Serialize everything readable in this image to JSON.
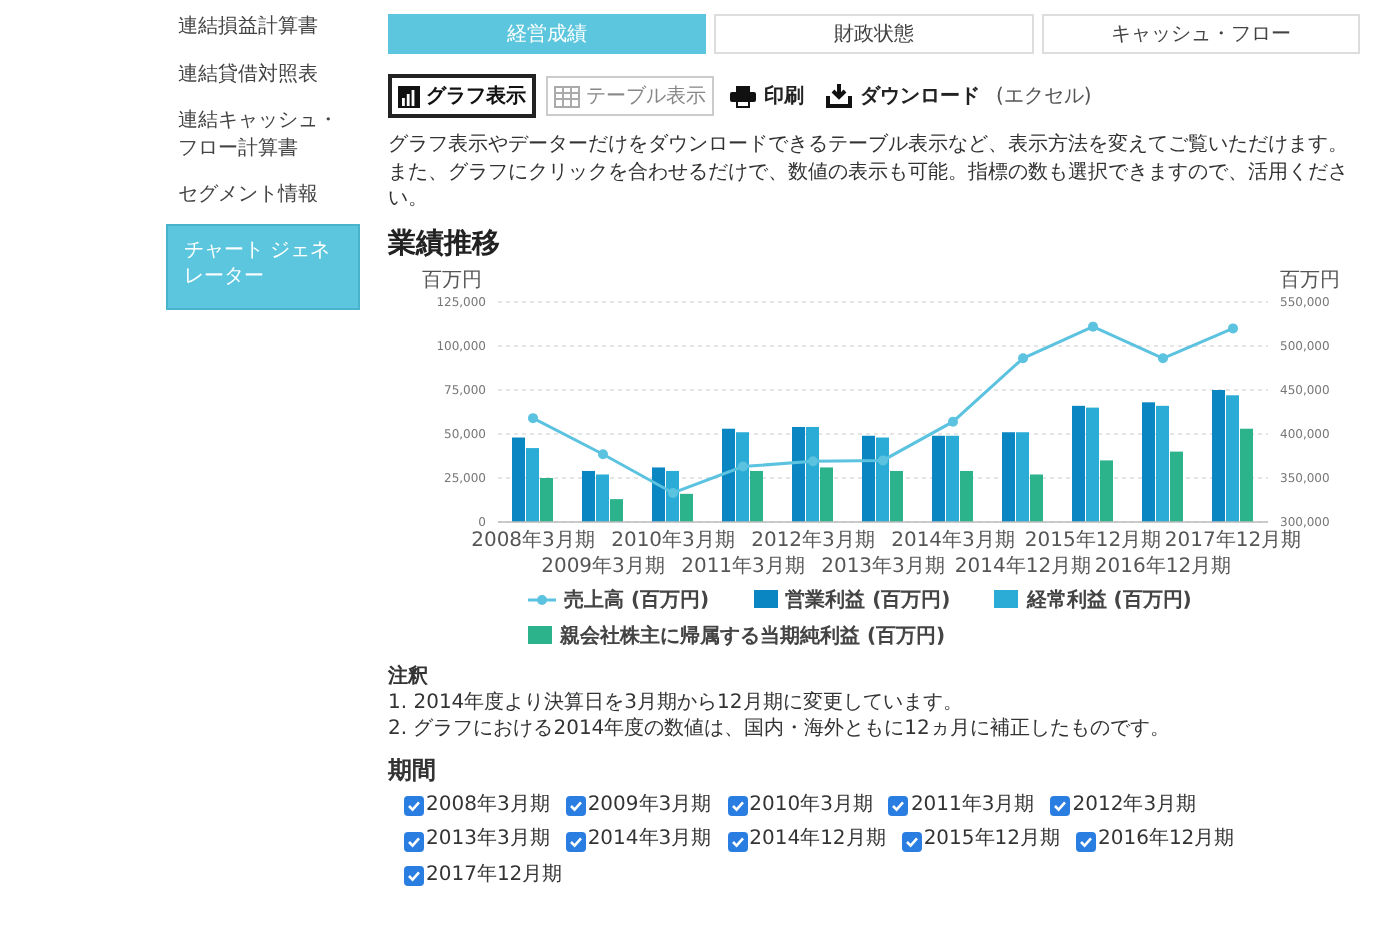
{
  "sidebar": {
    "items": [
      {
        "label": "連結損益計算書",
        "selected": false
      },
      {
        "label": "連結貸借対照表",
        "selected": false
      },
      {
        "label": "連結キャッシュ・フロー計算書",
        "selected": false
      },
      {
        "label": "セグメント情報",
        "selected": false
      },
      {
        "label": "チャート ジェネレーター",
        "selected": true
      }
    ]
  },
  "tabs": [
    {
      "label": "経営成績",
      "selected": true
    },
    {
      "label": "財政状態",
      "selected": false
    },
    {
      "label": "キャッシュ・フロー",
      "selected": false
    }
  ],
  "toolbar": {
    "views": [
      {
        "label": "グラフ表示",
        "kind": "graph",
        "selected": true
      },
      {
        "label": "テーブル表示",
        "kind": "table",
        "selected": false
      }
    ],
    "actions": [
      {
        "label": "印刷",
        "kind": "print"
      },
      {
        "label": "ダウンロード",
        "kind": "download",
        "note": "(エクセル)"
      }
    ]
  },
  "description": [
    "グラフ表示やデーターだけをダウンロードできるテーブル表示など、表示方法を変えてご覧いただけます。",
    "また、グラフにクリックを合わせるだけで、数値の表示も可能。指標の数も選択できますので、活用ください。"
  ],
  "section_title": "業績推移",
  "chart_data": {
    "type": "bar",
    "grid": true,
    "ylabel": "百万円",
    "y2label": "百万円",
    "categories": [
      "2008年3月期",
      "2009年3月期",
      "2010年3月期",
      "2011年3月期",
      "2012年3月期",
      "2013年3月期",
      "2014年3月期",
      "2014年12月期",
      "2015年12月期",
      "2016年12月期",
      "2017年12月期"
    ],
    "ylim": [
      0,
      125000
    ],
    "y2lim": [
      300000,
      550000
    ],
    "yticks": [
      {
        "value": 0,
        "label": "0"
      },
      {
        "value": 25000,
        "label": "25,000"
      },
      {
        "value": 50000,
        "label": "50,000"
      },
      {
        "value": 75000,
        "label": "75,000"
      },
      {
        "value": 100000,
        "label": "100,000"
      },
      {
        "value": 125000,
        "label": "125,000"
      }
    ],
    "y2ticks": [
      {
        "value": 300000,
        "label": "300,000"
      },
      {
        "value": 350000,
        "label": "350,000"
      },
      {
        "value": 400000,
        "label": "400,000"
      },
      {
        "value": 450000,
        "label": "450,000"
      },
      {
        "value": 500000,
        "label": "500,000"
      },
      {
        "value": 550000,
        "label": "550,000"
      }
    ],
    "series": [
      {
        "name": "売上高 (百万円)",
        "color": "#5bc2e0",
        "type": "line",
        "axis": "y2",
        "marker": true,
        "values": [
          418000,
          377000,
          333000,
          363000,
          369000,
          370000,
          414000,
          486000,
          522000,
          486000,
          520000
        ]
      },
      {
        "name": "営業利益 (百万円)",
        "color": "#0a86c2",
        "type": "bar",
        "values": [
          48000,
          29000,
          31000,
          53000,
          54000,
          49000,
          49000,
          51000,
          66000,
          68000,
          75000
        ]
      },
      {
        "name": "経常利益 (百万円)",
        "color": "#2bacd6",
        "type": "bar",
        "values": [
          42000,
          27000,
          29000,
          51000,
          54000,
          48000,
          49000,
          51000,
          65000,
          66000,
          72000
        ]
      },
      {
        "name": "親会社株主に帰属する当期純利益 (百万円)",
        "color": "#2db38c",
        "type": "bar",
        "values": [
          25000,
          13000,
          16000,
          29000,
          31000,
          29000,
          29000,
          27000,
          35000,
          40000,
          53000
        ]
      }
    ]
  },
  "notes": {
    "title": "注釈",
    "items": [
      "1. 2014年度より決算日を3月期から12月期に変更しています。",
      "2. グラフにおける2014年度の数値は、国内・海外ともに12ヵ月に補正したものです。"
    ]
  },
  "period": {
    "title": "期間",
    "options": [
      {
        "label": "2008年3月期",
        "checked": true
      },
      {
        "label": "2009年3月期",
        "checked": true
      },
      {
        "label": "2010年3月期",
        "checked": true
      },
      {
        "label": "2011年3月期",
        "checked": true
      },
      {
        "label": "2012年3月期",
        "checked": true
      },
      {
        "label": "2013年3月期",
        "checked": true
      },
      {
        "label": "2014年3月期",
        "checked": true
      },
      {
        "label": "2014年12月期",
        "checked": true
      },
      {
        "label": "2015年12月期",
        "checked": true
      },
      {
        "label": "2016年12月期",
        "checked": true
      },
      {
        "label": "2017年12月期",
        "checked": true
      }
    ]
  }
}
